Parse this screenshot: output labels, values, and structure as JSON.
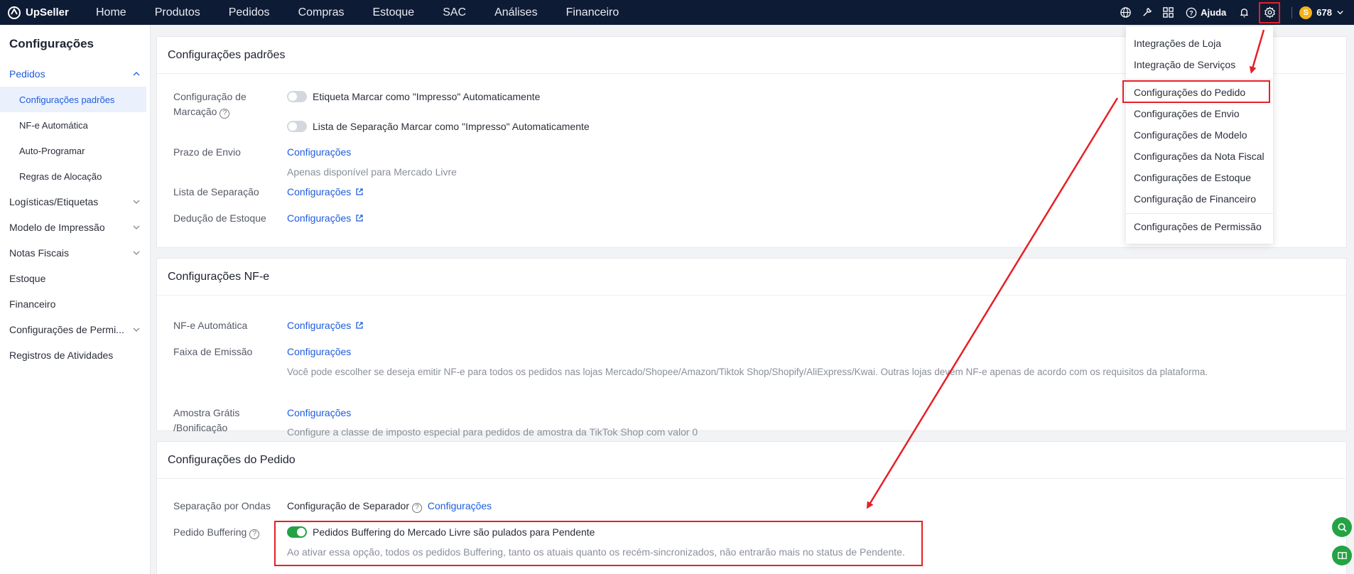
{
  "app": {
    "brand": "UpSeller"
  },
  "nav": {
    "items": [
      "Home",
      "Produtos",
      "Pedidos",
      "Compras",
      "Estoque",
      "SAC",
      "Análises",
      "Financeiro"
    ]
  },
  "topbar": {
    "help_label": "Ajuda",
    "points": "678"
  },
  "sidebar": {
    "title": "Configurações",
    "pedidos": "Pedidos",
    "sub": [
      "Configurações padrões",
      "NF-e Automática",
      "Auto-Programar",
      "Regras de Alocação"
    ],
    "groups": [
      "Logísticas/Etiquetas",
      "Modelo de Impressão",
      "Notas Fiscais"
    ],
    "plain": [
      "Estoque",
      "Financeiro",
      "Configurações de Permi...",
      "Registros de Atividades"
    ]
  },
  "card1": {
    "title": "Configurações padrões",
    "marcacao_label1": "Configuração de",
    "marcacao_label2": "Marcação",
    "toggle1_text": "Etiqueta Marcar como \"Impresso\" Automaticamente",
    "toggle2_text": "Lista de Separação Marcar como \"Impresso\" Automaticamente",
    "prazo_label": "Prazo de Envio",
    "prazo_link": "Configurações",
    "prazo_hint": "Apenas disponível para Mercado Livre",
    "lista_label": "Lista de Separação",
    "lista_link": "Configurações",
    "deducao_label": "Dedução de Estoque",
    "deducao_link": "Configurações"
  },
  "card2": {
    "title": "Configurações NF-e",
    "auto_label": "NF-e Automática",
    "auto_link": "Configurações",
    "faixa_label": "Faixa de Emissão",
    "faixa_link": "Configurações",
    "faixa_hint": "Você pode escolher se deseja emitir NF-e para todos os pedidos nas lojas Mercado/Shopee/Amazon/Tiktok Shop/Shopify/AliExpress/Kwai. Outras lojas devem NF-e apenas de acordo com os requisitos da plataforma.",
    "amostra_label1": "Amostra Grátis",
    "amostra_label2": "/Bonificação",
    "amostra_link": "Configurações",
    "amostra_hint": "Configure a classe de imposto especial para pedidos de amostra da TikTok Shop com valor 0"
  },
  "card3": {
    "title": "Configurações do Pedido",
    "ondas_label": "Separação por Ondas",
    "ondas_text": "Configuração de Separador",
    "ondas_link": "Configurações",
    "buffer_label": "Pedido Buffering",
    "buffer_toggle_text": "Pedidos Buffering do Mercado Livre são pulados para Pendente",
    "buffer_hint": "Ao ativar essa opção, todos os pedidos Buffering, tanto os atuais quanto os recém-sincronizados, não entrarão mais no status de Pendente."
  },
  "dropdown": {
    "items": [
      "Integrações de Loja",
      "Integração de Serviços",
      "Configurações do Pedido",
      "Configurações de Envio",
      "Configurações de Modelo",
      "Configurações da Nota Fiscal",
      "Configurações de Estoque",
      "Configuração de Financeiro",
      "Configurações de Permissão"
    ]
  },
  "colors": {
    "nav_bg": "#0e1b35",
    "accent": "#1d5ce0",
    "highlight": "#e52027",
    "toggle_on": "#25a244"
  }
}
